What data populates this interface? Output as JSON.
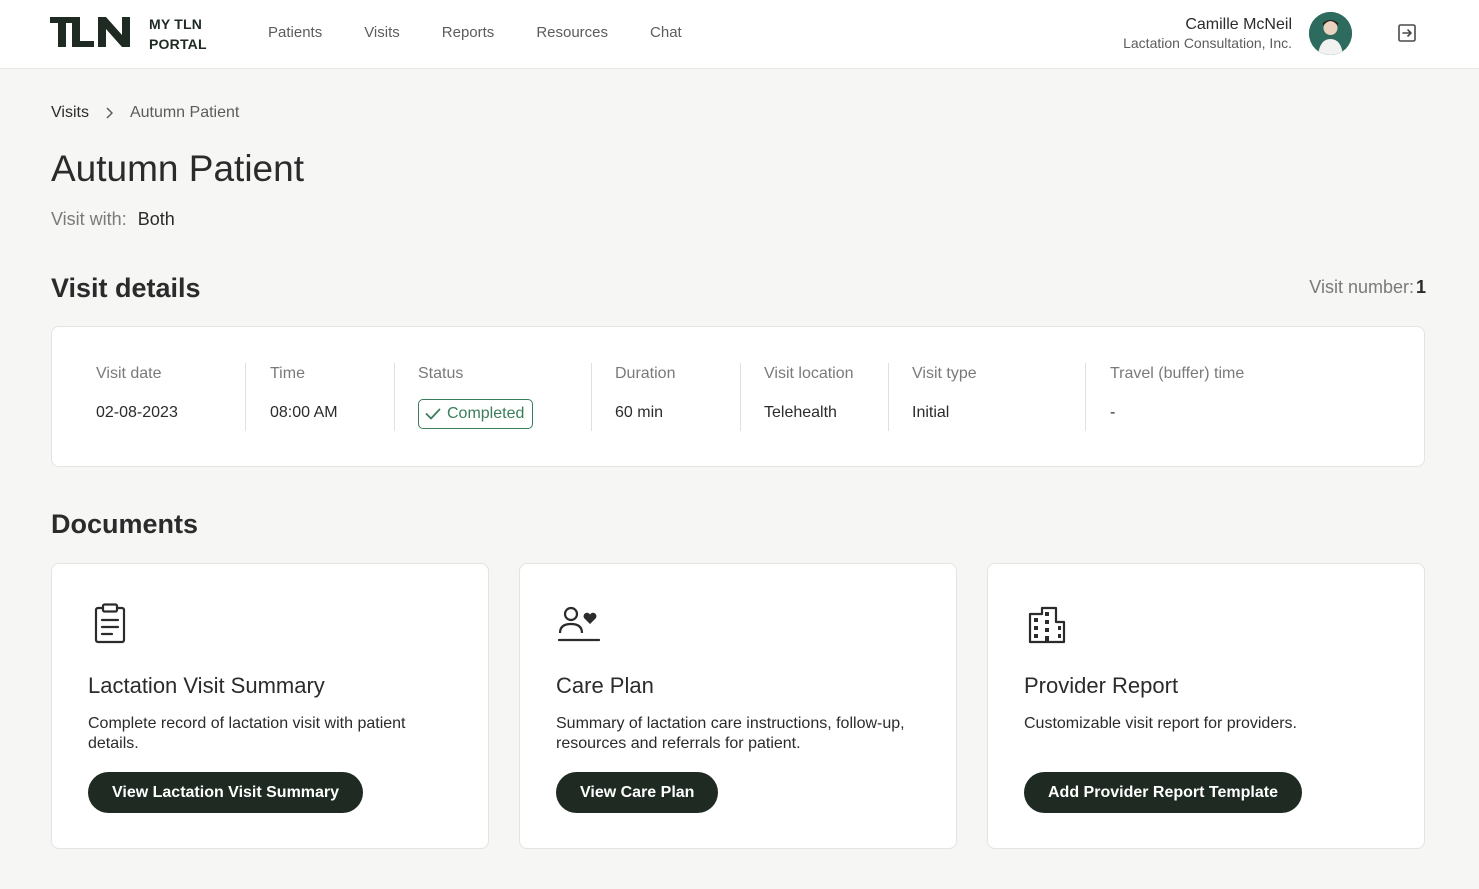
{
  "header": {
    "logo_line1": "MY TLN",
    "logo_line2": "PORTAL",
    "nav": [
      "Patients",
      "Visits",
      "Reports",
      "Resources",
      "Chat"
    ],
    "user_name": "Camille McNeil",
    "user_org": "Lactation Consultation, Inc.",
    "brand_color": "#1f2a22"
  },
  "breadcrumb": {
    "parent": "Visits",
    "current": "Autumn Patient"
  },
  "patient": {
    "name": "Autumn Patient",
    "visit_with_label": "Visit with:",
    "visit_with_value": "Both"
  },
  "visit_details": {
    "title": "Visit details",
    "visit_number_label": "Visit number:",
    "visit_number": "1",
    "columns": [
      {
        "label": "Visit date",
        "value": "02-08-2023"
      },
      {
        "label": "Time",
        "value": "08:00 AM"
      },
      {
        "label": "Status",
        "value": "Completed"
      },
      {
        "label": "Duration",
        "value": "60 min"
      },
      {
        "label": "Visit location",
        "value": "Telehealth"
      },
      {
        "label": "Visit type",
        "value": "Initial"
      },
      {
        "label": "Travel (buffer) time",
        "value": "-"
      }
    ],
    "status_color": "#3a7d5a"
  },
  "documents": {
    "title": "Documents",
    "cards": [
      {
        "icon": "clipboard-icon",
        "title": "Lactation Visit Summary",
        "description": "Complete record of lactation visit with patient details.",
        "button": "View Lactation Visit Summary"
      },
      {
        "icon": "person-heart-icon",
        "title": "Care Plan",
        "description": "Summary of lactation care instructions, follow-up, resources and referrals for patient.",
        "button": "View Care Plan"
      },
      {
        "icon": "building-icon",
        "title": "Provider Report",
        "description": "Customizable visit report for providers.",
        "button": "Add Provider Report Template"
      }
    ]
  }
}
